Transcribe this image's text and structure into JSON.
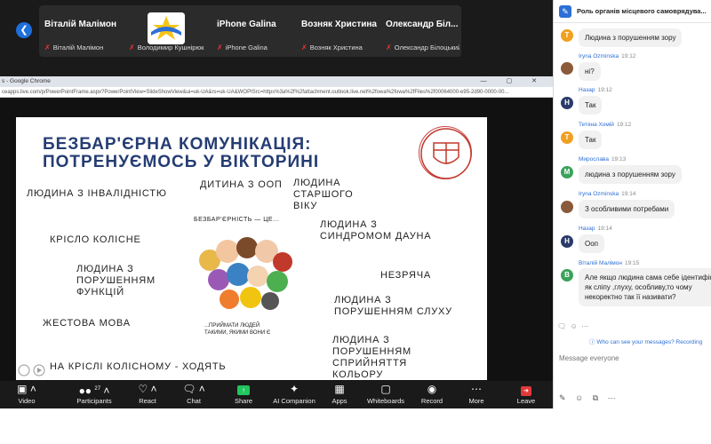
{
  "participants": [
    {
      "name": "Віталій Малімон",
      "sub": "Віталій Малімон"
    },
    {
      "name": "",
      "sub": "Володимир Кушнірюк"
    },
    {
      "name": "iPhone Galina",
      "sub": "iPhone Galina"
    },
    {
      "name": "Возняк Христина",
      "sub": "Возняк Христина"
    },
    {
      "name": "Олександр Біл...",
      "sub": "Олександр Білоцький"
    }
  ],
  "browser": {
    "title": "s - Google Chrome",
    "url": "ceapps.live.com/p/PowerPointFrame.aspx?PowerPointView=SlideShowView&ui=uk-UA&rs=uk-UA&WOPISrc=https%3a%2f%2fattachment.outlook.live.net%2fowa%2fowa%2fFiles%2f00064000-e95-2d90-0000-00..."
  },
  "slide": {
    "title_line1": "БЕЗБАР'ЄРНА КОМУНІКАЦІЯ:",
    "title_line2": "ПОТРЕНУЄМОСЬ У ВІКТОРИНІ",
    "items": {
      "disability": "ЛЮДИНА З ІНВАЛІДНІСТЮ",
      "child_oop": "ДИТИНА З ООП",
      "elderly": "ЛЮДИНА СТАРШОГО ВІКУ",
      "wheelchair": "КРІСЛО КОЛІСНЕ",
      "down": "ЛЮДИНА З СИНДРОМОМ ДАУНА",
      "functions": "ЛЮДИНА З ПОРУШЕННЯМ ФУНКЦІЙ",
      "clumsy": "НЕЗРЯЧА",
      "hearing": "ЛЮДИНА З ПОРУШЕННЯМ СЛУХУ",
      "sign": "ЖЕСТОВА МОВА",
      "color": "ЛЮДИНА З ПОРУШЕННЯМ СПРИЙНЯТТЯ КОЛЬОРУ",
      "walking": "НА КРІСЛІ КОЛІСНОМУ - ХОДЯТЬ"
    },
    "illustration_caption_top": "БЕЗБАР'ЄРНІСТЬ — ЦЕ...",
    "illustration_caption_bottom": "...ПРИЙМАТИ ЛЮДЕЙ ТАКИМИ, ЯКИМИ ВОНИ Є"
  },
  "toolbar": {
    "video": "Video",
    "participants": "Participants",
    "participants_count": "27",
    "react": "React",
    "chat": "Chat",
    "share": "Share",
    "ai": "AI Companion",
    "apps": "Apps",
    "whiteboards": "Whiteboards",
    "record": "Record",
    "more": "More",
    "leave": "Leave"
  },
  "chat": {
    "title": "Роль органів місцевого самоврядува...",
    "messages": [
      {
        "text": "Людина з порушенням зору"
      },
      {
        "sender": "Iryna Ozminska",
        "time": "19:12",
        "text": "ні?"
      },
      {
        "sender": "Назар",
        "time": "19:12",
        "text": "Так"
      },
      {
        "sender": "Тетяна Хомій",
        "time": "19:12",
        "text": "Так"
      },
      {
        "sender": "Мирослава",
        "time": "19:13",
        "text": "людина з порушенням зору"
      },
      {
        "sender": "Iryna Ozminska",
        "time": "19:14",
        "text": "З особливими потребами"
      },
      {
        "sender": "Назар",
        "time": "19:14",
        "text": "Ооп"
      },
      {
        "sender": "Віталій Малімон",
        "time": "19:15",
        "text": "Але якщо людина сама себе ідентифікує як сліпу ,глуху, особливу,то чому некоректно так її називати?"
      }
    ],
    "avatar_letters": {
      "T": "T",
      "H": "H",
      "M": "M",
      "V": "В"
    },
    "who_can_see": "Who can see your messages? Recording",
    "input_placeholder": "Message everyone"
  },
  "colors": {
    "accent": "#2d6fd6",
    "slide_title": "#253d73",
    "share_green": "#22c55e",
    "avatar_orange": "#f0a020",
    "avatar_navy": "#2a3a6a",
    "avatar_green": "#3aa35a"
  }
}
